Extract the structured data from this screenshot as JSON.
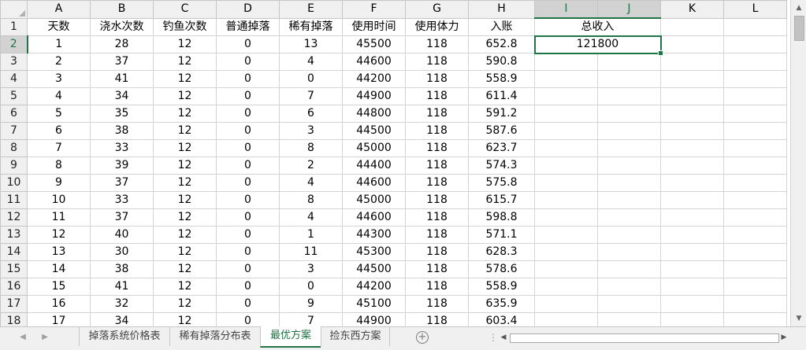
{
  "columns": [
    "A",
    "B",
    "C",
    "D",
    "E",
    "F",
    "G",
    "H",
    "I",
    "J",
    "K",
    "L"
  ],
  "header_row": [
    "天数",
    "浇水次数",
    "钓鱼次数",
    "普通掉落",
    "稀有掉落",
    "使用时间",
    "使用体力",
    "入账",
    "总收入"
  ],
  "rows": [
    [
      "1",
      "28",
      "12",
      "0",
      "13",
      "45500",
      "118",
      "652.8"
    ],
    [
      "2",
      "37",
      "12",
      "0",
      "4",
      "44600",
      "118",
      "590.8"
    ],
    [
      "3",
      "41",
      "12",
      "0",
      "0",
      "44200",
      "118",
      "558.9"
    ],
    [
      "4",
      "34",
      "12",
      "0",
      "7",
      "44900",
      "118",
      "611.4"
    ],
    [
      "5",
      "35",
      "12",
      "0",
      "6",
      "44800",
      "118",
      "591.2"
    ],
    [
      "6",
      "38",
      "12",
      "0",
      "3",
      "44500",
      "118",
      "587.6"
    ],
    [
      "7",
      "33",
      "12",
      "0",
      "8",
      "45000",
      "118",
      "623.7"
    ],
    [
      "8",
      "39",
      "12",
      "0",
      "2",
      "44400",
      "118",
      "574.3"
    ],
    [
      "9",
      "37",
      "12",
      "0",
      "4",
      "44600",
      "118",
      "575.8"
    ],
    [
      "10",
      "33",
      "12",
      "0",
      "8",
      "45000",
      "118",
      "615.7"
    ],
    [
      "11",
      "37",
      "12",
      "0",
      "4",
      "44600",
      "118",
      "598.8"
    ],
    [
      "12",
      "40",
      "12",
      "0",
      "1",
      "44300",
      "118",
      "571.1"
    ],
    [
      "13",
      "30",
      "12",
      "0",
      "11",
      "45300",
      "118",
      "628.3"
    ],
    [
      "14",
      "38",
      "12",
      "0",
      "3",
      "44500",
      "118",
      "578.6"
    ],
    [
      "15",
      "41",
      "12",
      "0",
      "0",
      "44200",
      "118",
      "558.9"
    ],
    [
      "16",
      "32",
      "12",
      "0",
      "9",
      "45100",
      "118",
      "635.9"
    ],
    [
      "17",
      "34",
      "12",
      "0",
      "7",
      "44900",
      "118",
      "603.4"
    ]
  ],
  "row_numbers": [
    "1",
    "2",
    "3",
    "4",
    "5",
    "6",
    "7",
    "8",
    "9",
    "10",
    "11",
    "12",
    "13",
    "14",
    "15",
    "16",
    "17",
    "18"
  ],
  "total_income_value": "121800",
  "sheet_tabs": [
    "掉落系统价格表",
    "稀有掉落分布表",
    "最优方案",
    "捡东西方案"
  ],
  "active_tab_index": 2,
  "colors": {
    "accent": "#217346",
    "header_bg": "#f0f0f0",
    "grid": "#d4d4d4"
  },
  "icons": {
    "add_sheet": "plus-circle-icon",
    "nav_prev": "chevron-left-icon",
    "nav_next": "chevron-right-icon"
  }
}
